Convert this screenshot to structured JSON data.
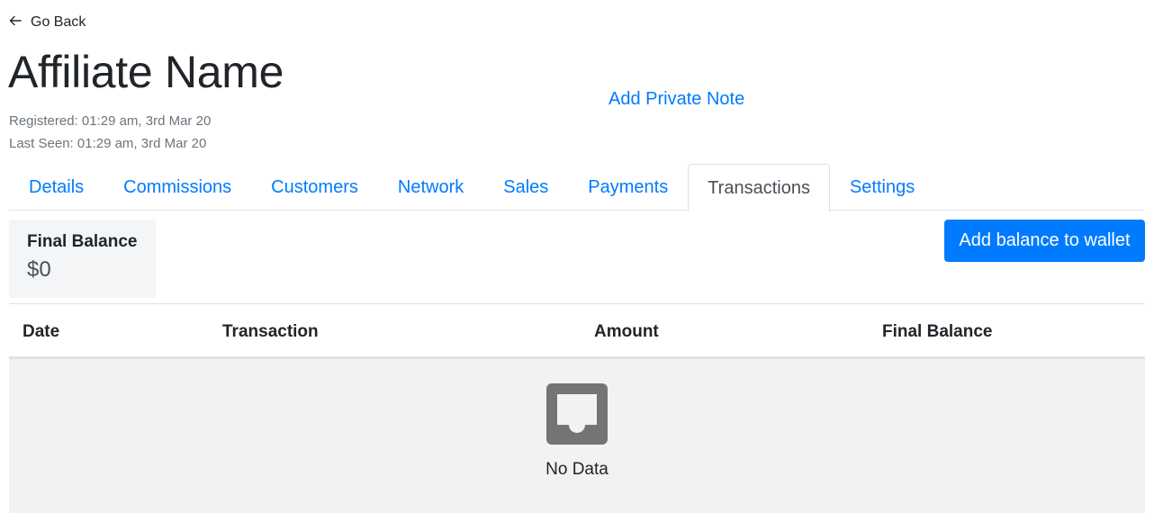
{
  "header": {
    "go_back_label": "Go Back",
    "title": "Affiliate Name",
    "registered": "Registered: 01:29 am, 3rd Mar 20",
    "last_seen": "Last Seen: 01:29 am, 3rd Mar 20",
    "private_note_label": "Add Private Note"
  },
  "tabs": [
    {
      "label": "Details",
      "active": false
    },
    {
      "label": "Commissions",
      "active": false
    },
    {
      "label": "Customers",
      "active": false
    },
    {
      "label": "Network",
      "active": false
    },
    {
      "label": "Sales",
      "active": false
    },
    {
      "label": "Payments",
      "active": false
    },
    {
      "label": "Transactions",
      "active": true
    },
    {
      "label": "Settings",
      "active": false
    }
  ],
  "balance": {
    "label": "Final Balance",
    "value": "$0"
  },
  "actions": {
    "add_balance_label": "Add balance to wallet"
  },
  "table": {
    "columns": [
      "Date",
      "Transaction",
      "Amount",
      "Final Balance"
    ],
    "rows": [],
    "empty_text": "No Data",
    "empty_icon": "inbox-icon"
  },
  "colors": {
    "accent": "#007bff",
    "text": "#212529",
    "muted": "#6c757d",
    "empty_bg": "#f2f2f2",
    "card_bg": "#f4f5f7"
  }
}
